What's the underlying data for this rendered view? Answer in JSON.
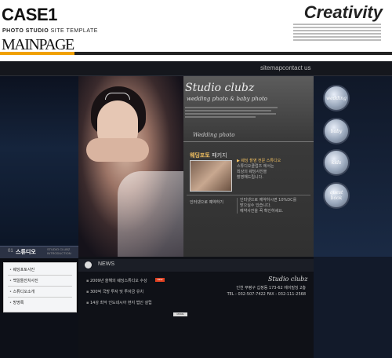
{
  "header": {
    "case_title": "CASE1",
    "case_sub_bold": "PHOTO STUDIO",
    "case_sub_rest": " SITE TEMPLATE",
    "main_page": "MAINPAGE",
    "creativity": "Creativity"
  },
  "topnav": {
    "sitemap": "sitemap",
    "contact_us": "contact us"
  },
  "hero": {
    "logo": "Studio clubz",
    "subtitle": "wedding photo & baby photo",
    "section_label": "Wedding photo"
  },
  "package": {
    "title": "웨딩포토",
    "title_suffix": "패키지",
    "lines": [
      "▶ 웨딩 촬영 전문 스튜디오",
      "스튜디오클럽즈 에서는",
      "최상의 웨딩사진을",
      "촬영해드립니다."
    ]
  },
  "event": {
    "left_lines": [
      "인터넷으로 예약하기"
    ],
    "right_lines": [
      "인터넷으로 예약하시면 10%DC를",
      "받으실수 있습니다.",
      "예약사진을 꼭 확인하세요."
    ]
  },
  "side_buttons": [
    "wedding",
    "baby",
    "kids",
    "quest book"
  ],
  "menu": {
    "num": "01",
    "title": "스튜디오",
    "title_en": "STUDIO CLUBZ INTRODUCTION",
    "items": [
      "웨딩포토사진",
      "백일돌잔치사진",
      "스튜디오소개",
      "방명록"
    ]
  },
  "news": {
    "label": "NEWS",
    "items": [
      "2009년 올해의 웨딩스튜디오 수상",
      "300억 국방 투자 및 투자금 유치",
      "14강 최악 인도네시아 현지 법인 설립"
    ],
    "new_badge": "NEW",
    "more": "MORE"
  },
  "footer": {
    "logo": "Studio clubz",
    "address": "인천 부평구 십정동 173-62 에이빌딩 2층",
    "tel": "TEL : 032-507-7422  FAX : 032-111-2568"
  }
}
